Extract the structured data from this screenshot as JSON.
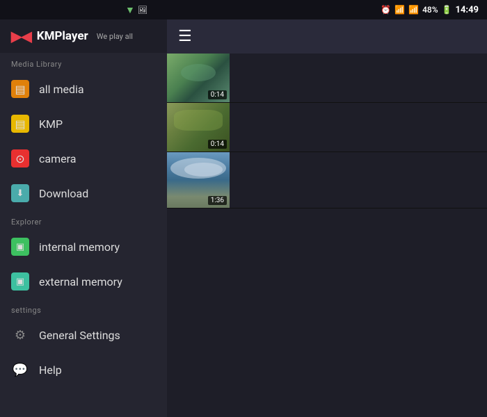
{
  "statusBar": {
    "time": "14:49",
    "battery": "48%",
    "signal": "signal"
  },
  "header": {
    "logoText": "KMPlayer",
    "tagline": "We play all"
  },
  "toolbar": {
    "hamburgerLabel": "☰"
  },
  "mediaLibrary": {
    "sectionLabel": "Media Library",
    "items": [
      {
        "id": "all-media",
        "label": "all media",
        "iconClass": "icon-all-media",
        "iconText": "▤"
      },
      {
        "id": "kmp",
        "label": "KMP",
        "iconClass": "icon-kmp",
        "iconText": "▤"
      },
      {
        "id": "camera",
        "label": "camera",
        "iconClass": "icon-camera",
        "iconText": "⊙"
      },
      {
        "id": "download",
        "label": "Download",
        "iconClass": "icon-download",
        "iconText": "⬇"
      }
    ]
  },
  "explorer": {
    "sectionLabel": "Explorer",
    "items": [
      {
        "id": "internal-memory",
        "label": "internal memory",
        "iconClass": "icon-internal",
        "iconText": "▣"
      },
      {
        "id": "external-memory",
        "label": "external memory",
        "iconClass": "icon-external",
        "iconText": "▣"
      }
    ]
  },
  "settings": {
    "sectionLabel": "settings",
    "items": [
      {
        "id": "general-settings",
        "label": "General Settings",
        "iconClass": "icon-settings",
        "iconText": "⚙"
      },
      {
        "id": "help",
        "label": "Help",
        "iconClass": "icon-help",
        "iconText": "💬"
      }
    ]
  },
  "videos": [
    {
      "id": "video1",
      "thumbClass": "thumb1",
      "duration": "0:14"
    },
    {
      "id": "video2",
      "thumbClass": "thumb2",
      "duration": "0:14"
    },
    {
      "id": "video3",
      "thumbClass": "thumb3",
      "duration": "1:36"
    }
  ]
}
